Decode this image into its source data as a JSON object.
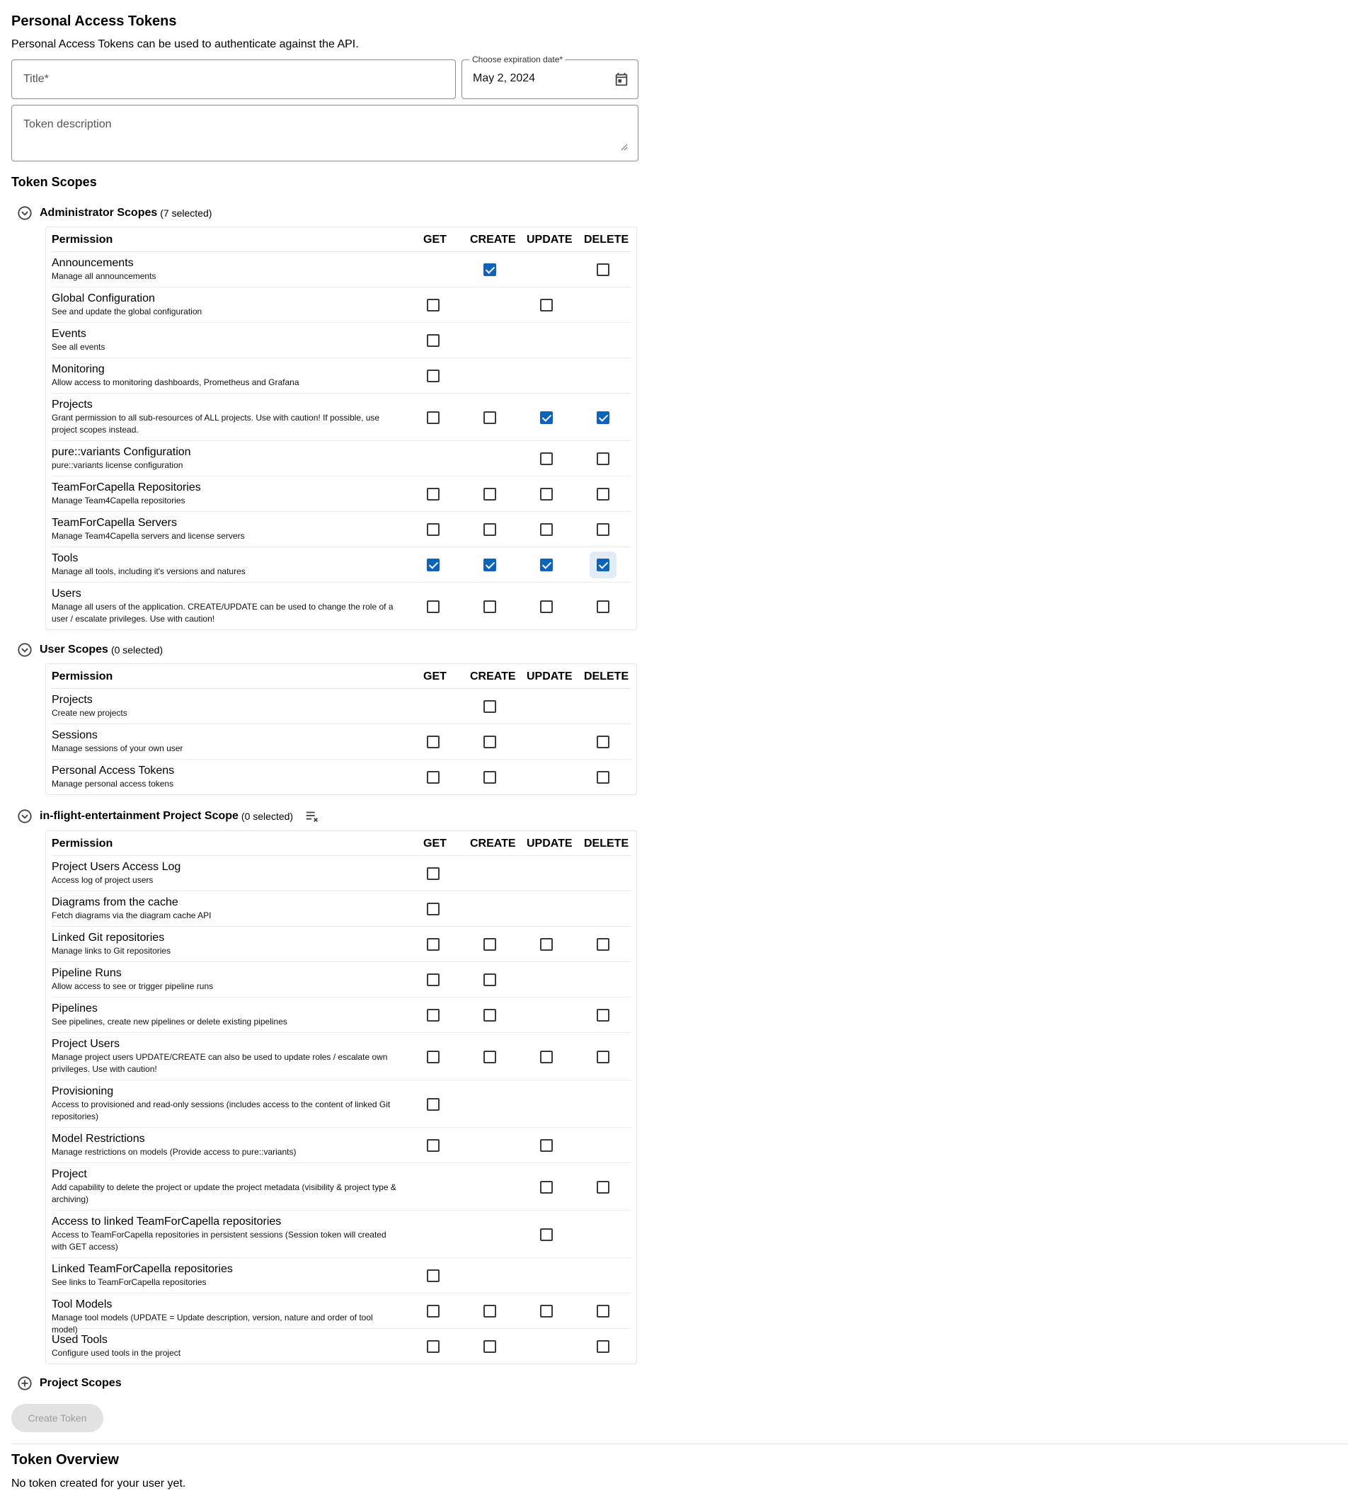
{
  "page": {
    "title": "Personal Access Tokens",
    "description": "Personal Access Tokens can be used to authenticate against the API."
  },
  "form": {
    "title_placeholder": "Title*",
    "expiration_label": "Choose expiration date*",
    "expiration_value": "May 2, 2024",
    "description_placeholder": "Token description"
  },
  "scopes_title": "Token Scopes",
  "table_headers": {
    "permission": "Permission",
    "get": "GET",
    "create": "CREATE",
    "update": "UPDATE",
    "delete": "DELETE"
  },
  "scope_groups": [
    {
      "name": "Administrator Scopes",
      "count": "(7 selected)",
      "rows": [
        {
          "name": "Announcements",
          "desc": "Manage all announcements",
          "get": null,
          "create": true,
          "update": null,
          "delete": false
        },
        {
          "name": "Global Configuration",
          "desc": "See and update the global configuration",
          "get": false,
          "create": null,
          "update": false,
          "delete": null
        },
        {
          "name": "Events",
          "desc": "See all events",
          "get": false,
          "create": null,
          "update": null,
          "delete": null
        },
        {
          "name": "Monitoring",
          "desc": "Allow access to monitoring dashboards, Prometheus and Grafana",
          "get": false,
          "create": null,
          "update": null,
          "delete": null
        },
        {
          "name": "Projects",
          "desc": "Grant permission to all sub-resources of ALL projects. Use with caution! If possible, use project scopes instead.",
          "get": false,
          "create": false,
          "update": true,
          "delete": true
        },
        {
          "name": "pure::variants Configuration",
          "desc": "pure::variants license configuration",
          "get": null,
          "create": null,
          "update": false,
          "delete": false
        },
        {
          "name": "TeamForCapella Repositories",
          "desc": "Manage Team4Capella repositories",
          "get": false,
          "create": false,
          "update": false,
          "delete": false
        },
        {
          "name": "TeamForCapella Servers",
          "desc": "Manage Team4Capella servers and license servers",
          "get": false,
          "create": false,
          "update": false,
          "delete": false
        },
        {
          "name": "Tools",
          "desc": "Manage all tools, including it's versions and natures",
          "get": true,
          "create": true,
          "update": true,
          "delete": true
        },
        {
          "name": "Users",
          "desc": "Manage all users of the application. CREATE/UPDATE can be used to change the role of a user / escalate privileges. Use with caution!",
          "get": false,
          "create": false,
          "update": false,
          "delete": false
        }
      ]
    },
    {
      "name": "User Scopes",
      "count": "(0 selected)",
      "rows": [
        {
          "name": "Projects",
          "desc": "Create new projects",
          "get": null,
          "create": false,
          "update": null,
          "delete": null
        },
        {
          "name": "Sessions",
          "desc": "Manage sessions of your own user",
          "get": false,
          "create": false,
          "update": null,
          "delete": false
        },
        {
          "name": "Personal Access Tokens",
          "desc": "Manage personal access tokens",
          "get": false,
          "create": false,
          "update": null,
          "delete": false
        }
      ]
    },
    {
      "name": "in-flight-entertainment Project Scope",
      "count": "(0 selected)",
      "rows": [
        {
          "name": "Project Users Access Log",
          "desc": "Access log of project users",
          "get": false,
          "create": null,
          "update": null,
          "delete": null
        },
        {
          "name": "Diagrams from the cache",
          "desc": "Fetch diagrams via the diagram cache API",
          "get": false,
          "create": null,
          "update": null,
          "delete": null
        },
        {
          "name": "Linked Git repositories",
          "desc": "Manage links to Git repositories",
          "get": false,
          "create": false,
          "update": false,
          "delete": false
        },
        {
          "name": "Pipeline Runs",
          "desc": "Allow access to see or trigger pipeline runs",
          "get": false,
          "create": false,
          "update": null,
          "delete": null
        },
        {
          "name": "Pipelines",
          "desc": "See pipelines, create new pipelines or delete existing pipelines",
          "get": false,
          "create": false,
          "update": null,
          "delete": false
        },
        {
          "name": "Project Users",
          "desc": "Manage project users UPDATE/CREATE can also be used to update roles / escalate own privileges. Use with caution!",
          "get": false,
          "create": false,
          "update": false,
          "delete": false
        },
        {
          "name": "Provisioning",
          "desc": "Access to provisioned and read-only sessions (includes access to the content of linked Git repositories)",
          "get": false,
          "create": null,
          "update": null,
          "delete": null
        },
        {
          "name": "Model Restrictions",
          "desc": "Manage restrictions on models (Provide access to pure::variants)",
          "get": false,
          "create": null,
          "update": false,
          "delete": null
        },
        {
          "name": "Project",
          "desc": "Add capability to delete the project or update the project metadata (visibility & project type & archiving)",
          "get": null,
          "create": null,
          "update": false,
          "delete": false
        },
        {
          "name": "Access to linked TeamForCapella repositories",
          "desc": "Access to TeamForCapella repositories in persistent sessions (Session token will created with GET access)",
          "get": null,
          "create": null,
          "update": false,
          "delete": null
        },
        {
          "name": "Linked TeamForCapella repositories",
          "desc": "See links to TeamForCapella repositories",
          "get": false,
          "create": null,
          "update": null,
          "delete": null
        },
        {
          "name": "Tool Models",
          "desc": "Manage tool models (UPDATE = Update description, version, nature and order of tool model)",
          "get": false,
          "create": false,
          "update": false,
          "delete": false
        },
        {
          "name": "Used Tools",
          "desc": "Configure used tools in the project",
          "get": false,
          "create": false,
          "update": null,
          "delete": false
        }
      ]
    }
  ],
  "project_scopes_label": "Project Scopes",
  "create_button": "Create Token",
  "overview": {
    "title": "Token Overview",
    "empty_text": "No token created for your user yet."
  },
  "colors": {
    "accent": "#0f63b8",
    "disabled_bg": "#e2e2e2"
  },
  "icons": {
    "calendar": "calendar-icon",
    "collapse": "chevron-circle-icon",
    "expand": "plus-circle-icon",
    "clear": "clear-all-icon"
  }
}
